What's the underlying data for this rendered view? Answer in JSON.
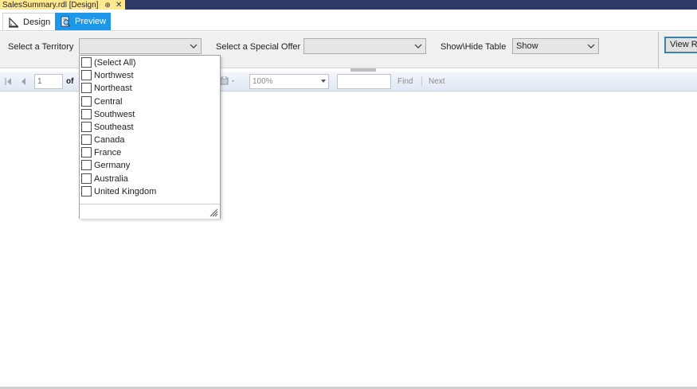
{
  "document_tab": {
    "title": "SalesSummary.rdl [Design]",
    "pin_glyph": "⊕",
    "close_glyph": "✕"
  },
  "view_tabs": {
    "design_label": "Design",
    "preview_label": "Preview"
  },
  "parameters": {
    "territory_label": "Select a Territory",
    "territory_value": "",
    "special_offer_label": "Select a Special Offer",
    "special_offer_value": "",
    "show_hide_label": "Show\\Hide Table",
    "show_hide_value": "Show",
    "view_report_label": "View Report"
  },
  "toolbar": {
    "page_number": "1",
    "of_label": "of",
    "zoom_value": "100%",
    "find_label": "Find",
    "next_label": "Next"
  },
  "territory_dropdown": {
    "options": [
      {
        "label": "(Select All)",
        "checked": false
      },
      {
        "label": "Northwest",
        "checked": false
      },
      {
        "label": "Northeast",
        "checked": false
      },
      {
        "label": "Central",
        "checked": false
      },
      {
        "label": "Southwest",
        "checked": false
      },
      {
        "label": "Southeast",
        "checked": false
      },
      {
        "label": "Canada",
        "checked": false
      },
      {
        "label": "France",
        "checked": false
      },
      {
        "label": "Germany",
        "checked": false
      },
      {
        "label": "Australia",
        "checked": false
      },
      {
        "label": "United Kingdom",
        "checked": false
      }
    ]
  },
  "colors": {
    "doc_tab_bg": "#ffe88f",
    "doc_tabbar_bg": "#2d3a66",
    "preview_tab_bg": "#1c97ea",
    "view_report_border": "#3c7fb1"
  }
}
